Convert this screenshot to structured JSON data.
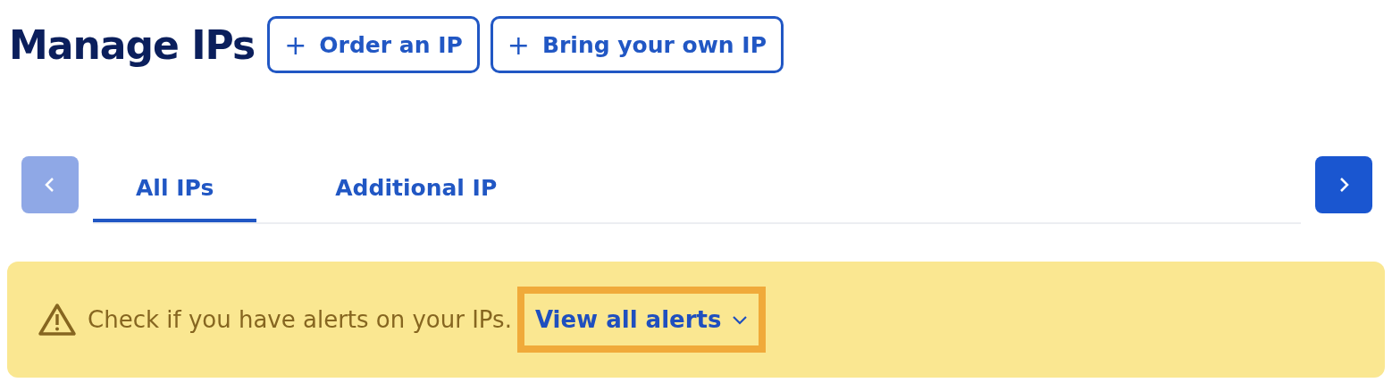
{
  "title": "Manage IPs",
  "actions": [
    {
      "icon": "+",
      "label": "Order an IP"
    },
    {
      "icon": "+",
      "label": "Bring your own IP"
    }
  ],
  "tabs_nav": {
    "prev_disabled": true,
    "next_disabled": false
  },
  "tabs": [
    {
      "label": "All IPs",
      "selected": true
    },
    {
      "label": "Additional IP",
      "selected": false
    }
  ],
  "alert": {
    "message": "Check if you have alerts on your IPs.",
    "link": "View all alerts",
    "link_highlighted": true
  }
}
